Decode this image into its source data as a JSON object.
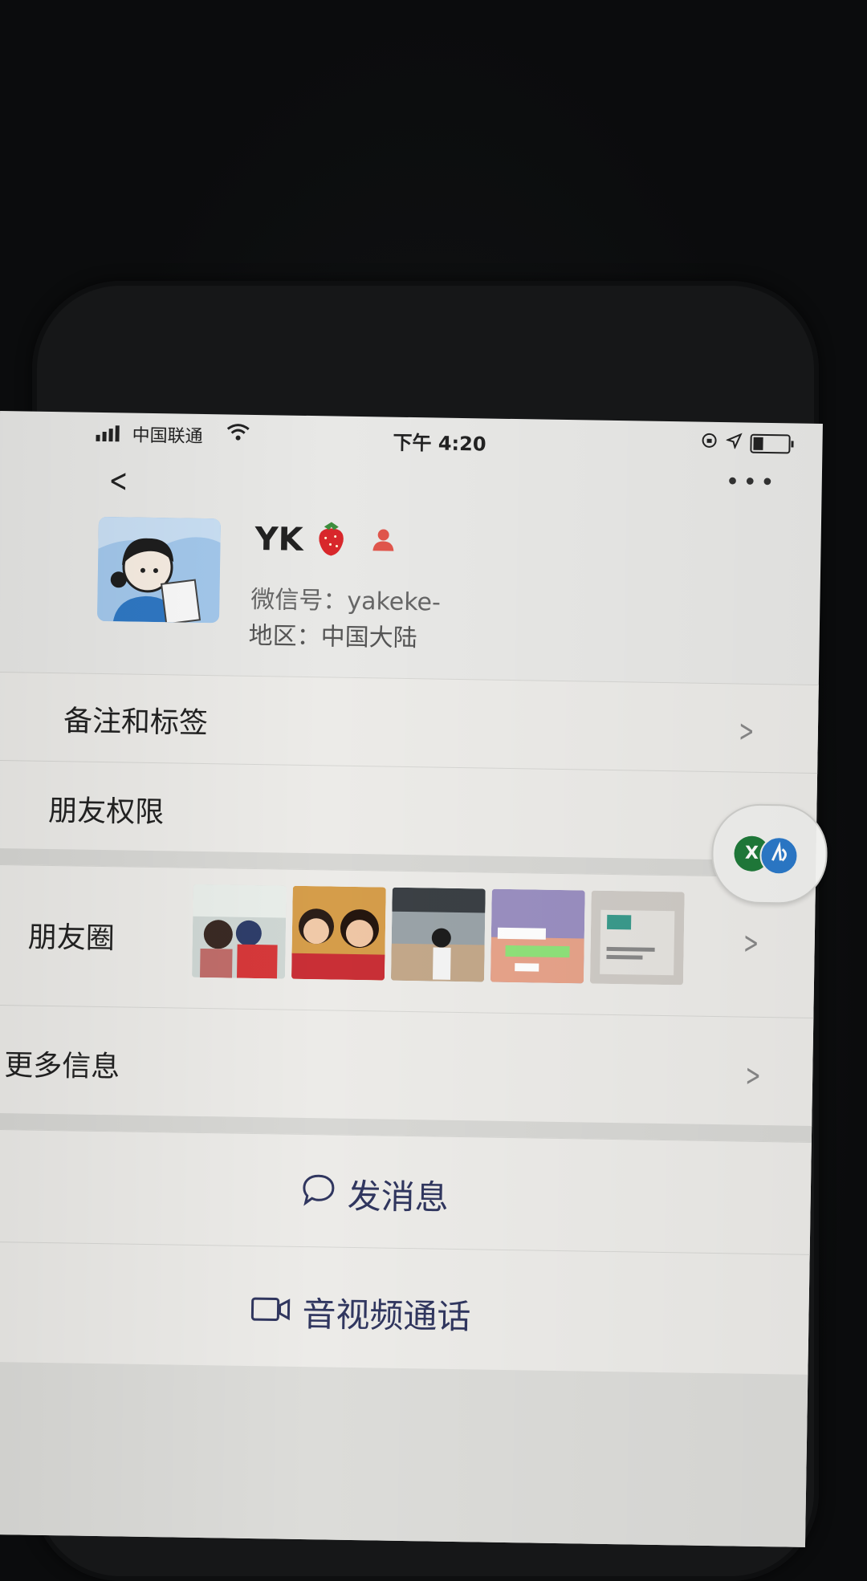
{
  "status_bar": {
    "carrier": "中国联通",
    "time": "下午 4:20"
  },
  "profile": {
    "name": "YK",
    "wechat_id": "微信号：yakeke-",
    "region": "地区：中国大陆"
  },
  "rows": {
    "remarks_tags": "备注和标签",
    "friend_permissions": "朋友权限",
    "moments": "朋友圈",
    "more_info": "更多信息"
  },
  "actions": {
    "send_message": "发消息",
    "video_call": "音视频通话"
  },
  "floater": {
    "badge1": "X"
  },
  "colors": {
    "action_text": "#30365f",
    "screen_bg": "#ecebe8",
    "floater_green": "#1f7a3a",
    "floater_blue": "#2b79c9"
  },
  "icons": [
    "back-arrow-icon",
    "more-options-icon",
    "strawberry-icon",
    "person-badge-icon",
    "chevron-right-icon",
    "chat-bubble-icon",
    "video-camera-icon",
    "signal-icon",
    "wifi-icon",
    "lock-rotation-icon",
    "location-icon",
    "battery-icon"
  ]
}
